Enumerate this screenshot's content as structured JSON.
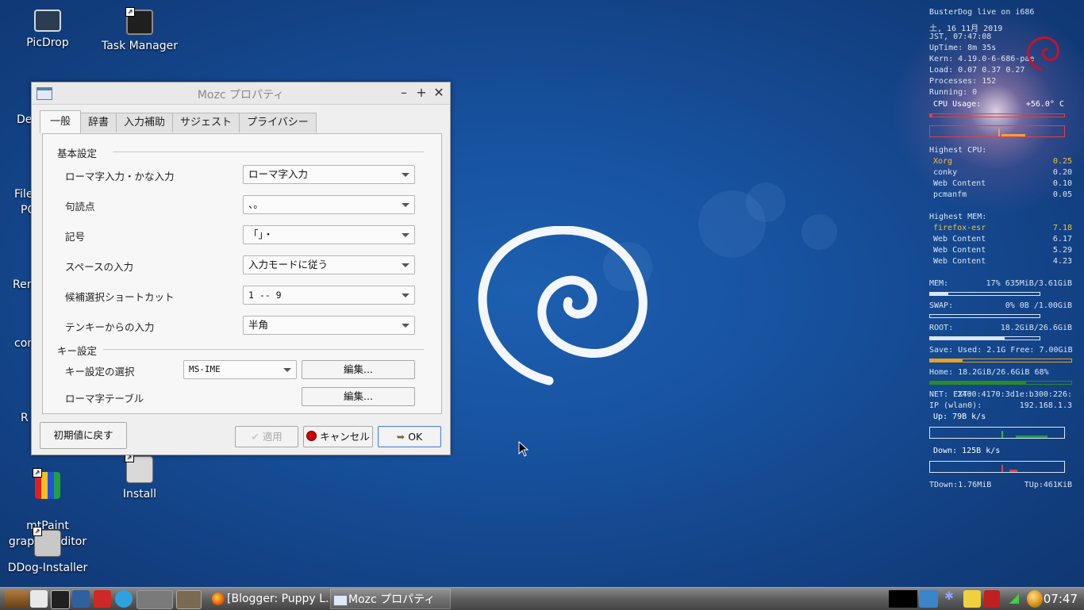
{
  "desktop": {
    "icons": [
      {
        "label": "PicDrop"
      },
      {
        "label": "Task Manager"
      },
      {
        "label": "mtPaint\ngraphic editor"
      },
      {
        "label": "Install"
      },
      {
        "label": "DDog-Installer"
      }
    ],
    "clipped_labels": [
      "De",
      "File",
      "PC",
      "Ren",
      "con",
      "R"
    ]
  },
  "dialog": {
    "title": "Mozc プロパティ",
    "tabs": [
      "一般",
      "辞書",
      "入力補助",
      "サジェスト",
      "プライバシー"
    ],
    "active_tab": "一般",
    "group_basic": "基本設定",
    "rows": [
      {
        "label": "ローマ字入力・かな入力",
        "value": "ローマ字入力"
      },
      {
        "label": "句読点",
        "value": "、。"
      },
      {
        "label": "記号",
        "value": "「」・"
      },
      {
        "label": "スペースの入力",
        "value": "入力モードに従う"
      },
      {
        "label": "候補選択ショートカット",
        "value": "1 -- 9"
      },
      {
        "label": "テンキーからの入力",
        "value": "半角"
      }
    ],
    "group_key": "キー設定",
    "key_select_label": "キー設定の選択",
    "key_select_value": "MS-IME",
    "edit_label": "編集...",
    "romaji_table_label": "ローマ字テーブル",
    "edit2_label": "編集...",
    "reset_label": "初期値に戻す",
    "apply_label": "適用",
    "cancel_label": "キャンセル",
    "ok_label": "OK"
  },
  "conky": {
    "header": "BusterDog live on i686",
    "date": "土,  16 11月 2019",
    "time": "JST,    07:47:08",
    "uptime": "UpTime: 8m 35s",
    "kern": "Kern: 4.19.0-6-686-pae",
    "load": "Load: 0.07 0.37 0.27",
    "processes": "Processes: 152",
    "running": "Running: 0",
    "cpu_usage_label": "CPU Usage:",
    "cpu_temp": "+56.0° C",
    "highest_cpu_label": "Highest CPU:",
    "top_cpu": [
      {
        "name": "Xorg",
        "val": "0.25"
      },
      {
        "name": "conky",
        "val": "0.20"
      },
      {
        "name": "Web Content",
        "val": "0.10"
      },
      {
        "name": "pcmanfm",
        "val": "0.05"
      }
    ],
    "highest_mem_label": "Highest MEM:",
    "top_mem": [
      {
        "name": "firefox-esr",
        "val": "7.18"
      },
      {
        "name": "Web Content",
        "val": "6.17"
      },
      {
        "name": "Web Content",
        "val": "5.29"
      },
      {
        "name": "Web Content",
        "val": "4.23"
      }
    ],
    "mem_label": "MEM:",
    "mem_val": "17% 635MiB/3.61GiB",
    "mem_frac": 0.17,
    "swap_label": "SWAP:",
    "swap_val": "0% 0B  /1.00GiB",
    "swap_frac": 0.0,
    "root_label": "ROOT:",
    "root_val": "18.2GiB/26.6GiB",
    "root_frac": 0.68,
    "save_line": "Save: Used: 2.1G Free: 7.00GiB",
    "save_frac": 0.23,
    "home_line": "Home: 18.2GiB/26.6GiB 68%",
    "home_frac": 0.68,
    "net_label": "NET: EXT:",
    "net_ext": "2400:4170:3d1e:b300:226:",
    "ip_label": "IP (wlan0):",
    "ip_val": "192.168.1.3",
    "up_line": "Up: 79B   k/s",
    "down_line": "Down: 125B  k/s",
    "tdown": "TDown:1.76MiB",
    "tup": "TUp:461KiB",
    "colors": {
      "highlight": "#f0c040",
      "bar_save": "#e8a020",
      "bar_home": "#2a8a2a",
      "bar_cpu": "#e04040"
    }
  },
  "taskbar": {
    "tasks": [
      "[Blogger: Puppy L...",
      "Mozc プロパティ"
    ],
    "clock": "07:47"
  }
}
